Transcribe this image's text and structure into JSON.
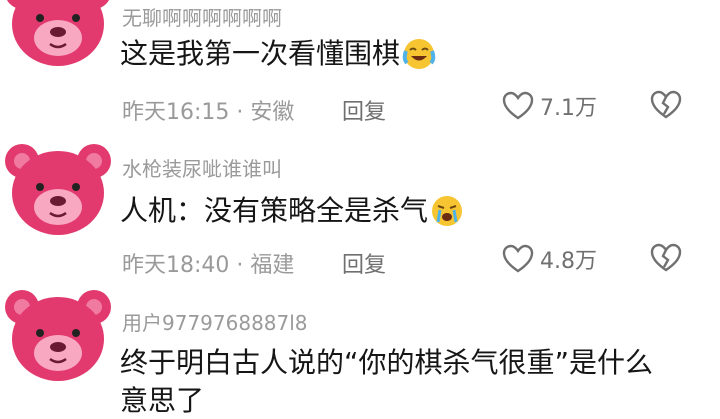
{
  "colors": {
    "avatar_pink": "#e23a6e",
    "avatar_light": "#f9a8c2",
    "meta_gray": "#9a9a9a",
    "text_dark": "#161616"
  },
  "comments": [
    {
      "username": "无聊啊啊啊啊啊啊",
      "text": "这是我第一次看懂围棋",
      "emoji": "crying-laugh-emoji",
      "time_location": "昨天16:15 · 安徽",
      "reply_label": "回复",
      "likes": "7.1万",
      "avatar": "pink-bear-avatar"
    },
    {
      "username": "水枪装尿呲谁谁叫",
      "text": "人机：没有策略全是杀气",
      "emoji": "crying-emoji",
      "time_location": "昨天18:40 · 福建",
      "reply_label": "回复",
      "likes": "4.8万",
      "avatar": "pink-bear-avatar"
    },
    {
      "username": "用户9779768887l8",
      "text_line1": "终于明白古人说的“你的棋杀气很重”是什么",
      "text_line2": "意思了",
      "avatar": "pink-bear-avatar"
    }
  ]
}
